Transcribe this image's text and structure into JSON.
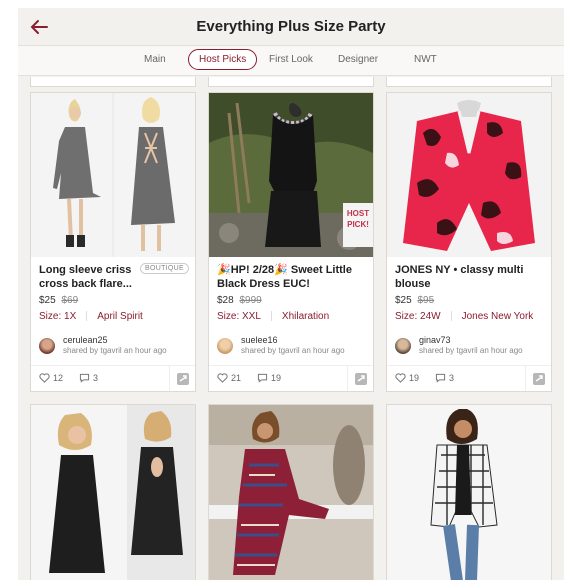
{
  "header": {
    "title": "Everything Plus Size Party"
  },
  "tabs": [
    {
      "label": "Main"
    },
    {
      "label": "Host Picks"
    },
    {
      "label": "First Look"
    },
    {
      "label": "Designer"
    },
    {
      "label": "NWT"
    }
  ],
  "listings": [
    {
      "title": "Long sleeve criss cross back flare...",
      "badge": "BOUTIQUE",
      "price": "$25",
      "original_price": "$69",
      "size": "Size: 1X",
      "brand": "April Spirit",
      "seller": "cerulean25",
      "shared": "shared by tgavril an hour ago",
      "likes": "12",
      "comments": "3"
    },
    {
      "title": "🎉HP! 2/28🎉 Sweet Little Black Dress EUC!",
      "price": "$28",
      "original_price": "$999",
      "size": "Size: XXL",
      "brand": "Xhilaration",
      "seller": "suelee16",
      "shared": "shared by tgavril an hour ago",
      "likes": "21",
      "comments": "19",
      "stamp": "HOST PICK!"
    },
    {
      "title": "JONES NY • classy multi blouse",
      "price": "$25",
      "original_price": "$95",
      "size": "Size: 24W",
      "brand": "Jones New York",
      "seller": "ginav73",
      "shared": "shared by tgavril an hour ago",
      "likes": "19",
      "comments": "3"
    }
  ],
  "colors": {
    "accent": "#8a1d2f",
    "background": "#f3f1ee"
  }
}
